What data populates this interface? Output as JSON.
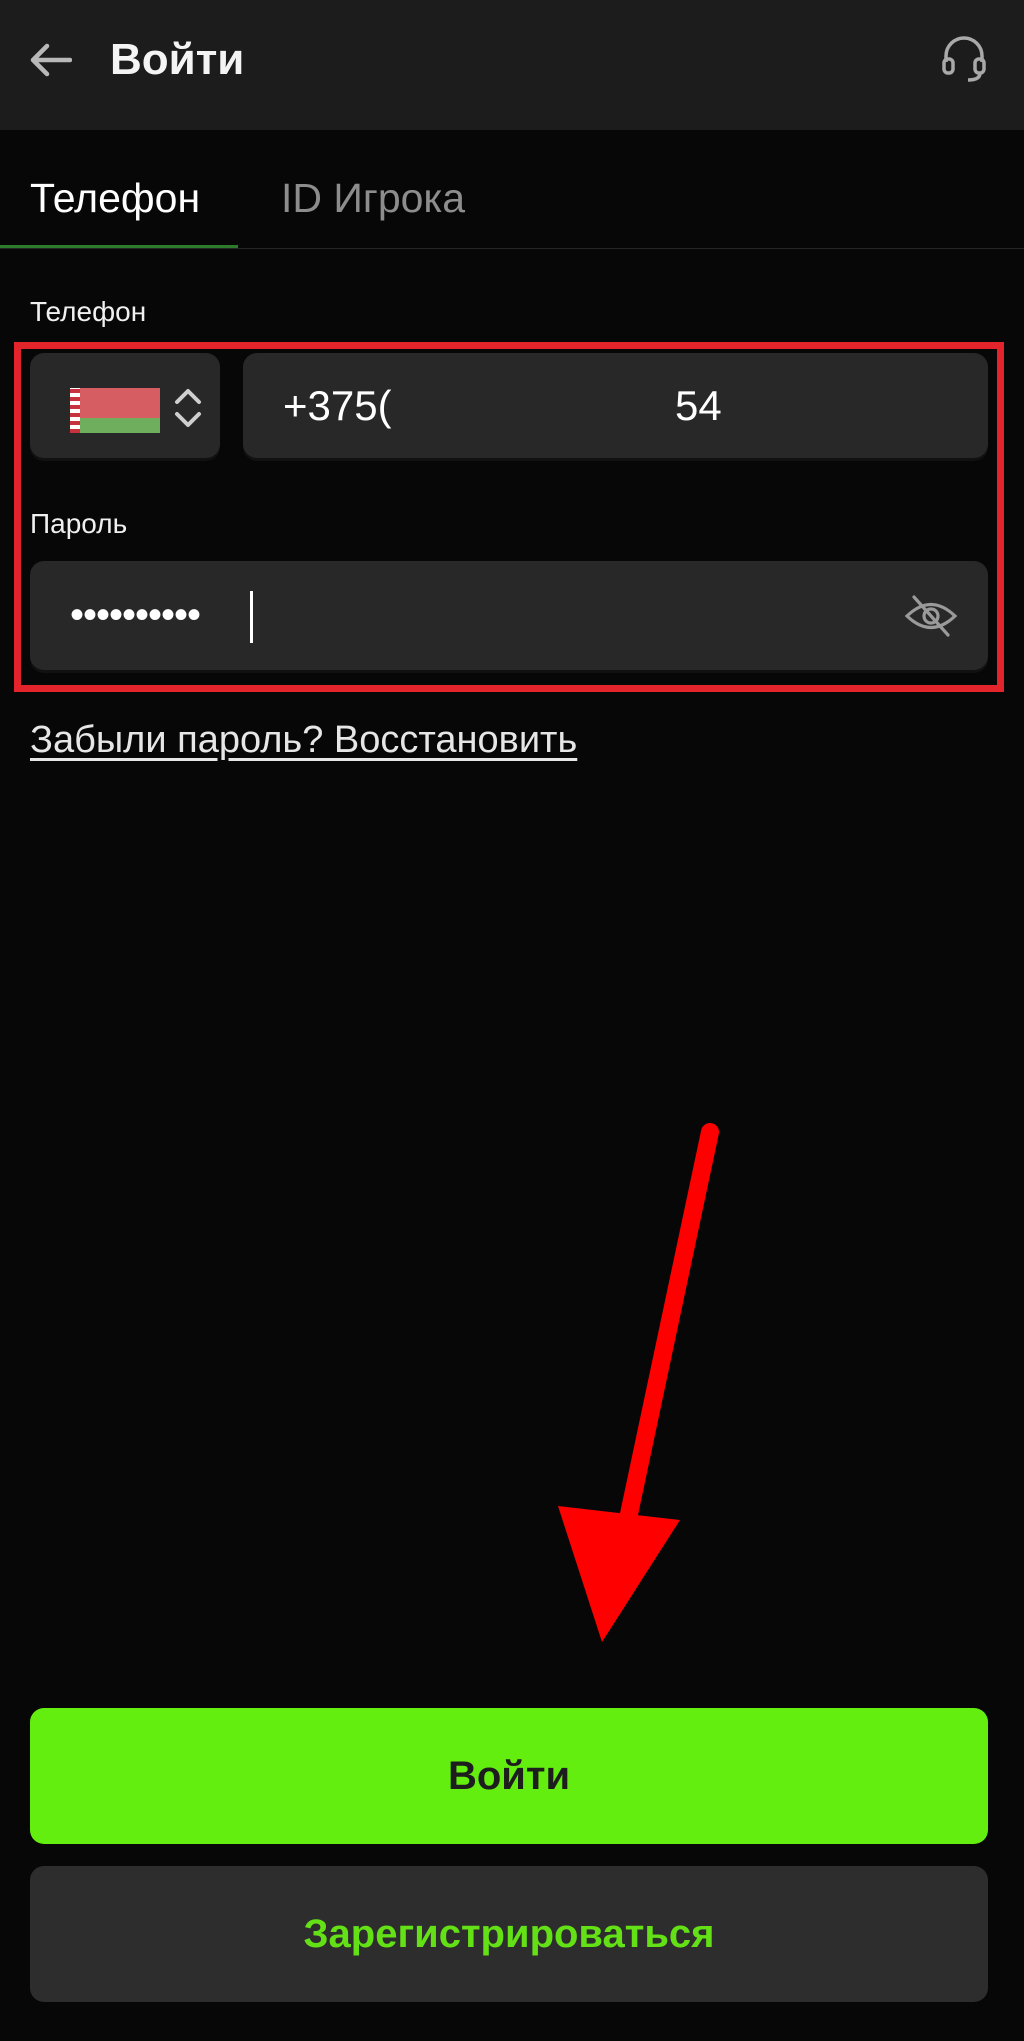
{
  "header": {
    "title": "Войти",
    "back_icon": "arrow-left-icon",
    "support_icon": "headset-icon"
  },
  "tabs": [
    {
      "label": "Телефон",
      "active": true
    },
    {
      "label": "ID Игрока",
      "active": false
    }
  ],
  "form": {
    "phone_label": "Телефон",
    "country": {
      "flag_icon": "belarus-flag-icon",
      "selector_icon": "chevron-up-down-icon"
    },
    "phone_value_prefix": "+375(",
    "phone_value_suffix": "54",
    "password_label": "Пароль",
    "password_value": "••••••••••",
    "eye_icon": "eye-off-icon"
  },
  "forgot_link": "Забыли пароль? Восстановить",
  "buttons": {
    "login": "Войти",
    "register": "Зарегистрироваться"
  },
  "colors": {
    "accent_green": "#64ee0f",
    "highlight_red": "#e3242b",
    "field_bg": "#282828",
    "header_bg": "#1c1c1c"
  }
}
